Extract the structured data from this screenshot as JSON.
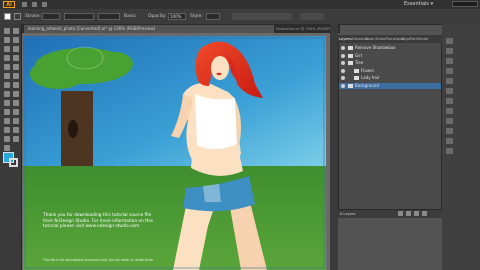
{
  "app": {
    "logo_text": "Ai",
    "workspace_label": "Essentials ▾"
  },
  "controlbar": {
    "stroke_label": "Stroke:",
    "opacity_label": "Opacity:",
    "opacity_value": "100%",
    "style_label": "Style:",
    "basic_label": "Basic"
  },
  "document": {
    "tab_title": "learning_artwork_photo [Converted].ai* @ 156% (RGB/Preview)",
    "tab2_title": "illustration.ai @ 100% (RGB/Preview)"
  },
  "layers_panel": {
    "tabs": [
      "Layers",
      "Artboards",
      "Color",
      "Stroke",
      "Transform",
      "Align",
      "Pathfinder"
    ],
    "rows": [
      "Remove Shadowbox",
      "Girl",
      "Tree",
      "Flower",
      "Lady hair",
      "Background"
    ],
    "footer_label": "6 Layers"
  },
  "canvas": {
    "info_text": "Thank you for downloading this tutorial source file from N-Design Studio. For more information on this tutorial please visit www.ndesign-studio.com",
    "fine_print": "This file is for educational purposes only. Do not resell or redistribute."
  },
  "colors": {
    "accent": "#f7a01e",
    "sky_top": "#2a7fbf",
    "grass": "#3f8e2f",
    "selection": "#3d6ea1"
  }
}
